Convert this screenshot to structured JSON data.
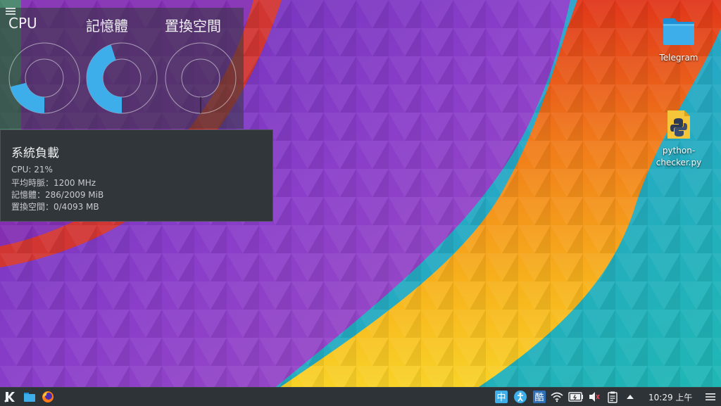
{
  "monitor": {
    "gauges": [
      {
        "title": "CPU",
        "fraction": 0.21
      },
      {
        "title": "記憶體",
        "fraction": 0.45
      },
      {
        "title": "置換空間",
        "fraction": 0.0
      }
    ]
  },
  "tooltip": {
    "title": "系統負載",
    "lines": [
      "CPU: 21%",
      "平均時脈：1200 MHz",
      "記憶體：286/2009 MiB",
      "置換空間：0/4093 MB"
    ]
  },
  "desktop": {
    "icons": [
      {
        "label": "Telegram",
        "icon": "folder-icon"
      },
      {
        "label": "python-checker.py",
        "icon": "python-file-icon"
      }
    ]
  },
  "panel": {
    "clock": "10:29 上午",
    "launcher_icon": "kde-logo-icon",
    "tray": [
      "input-method-icon",
      "accessibility-icon",
      "chewing-input-icon",
      "wifi-icon",
      "battery-icon",
      "volume-muted-icon",
      "clipboard-icon",
      "expand-arrow-icon"
    ]
  },
  "colors": {
    "accent": "#3daee9",
    "panel_bg": "#2e3338",
    "tooltip_bg": "#31363b"
  }
}
